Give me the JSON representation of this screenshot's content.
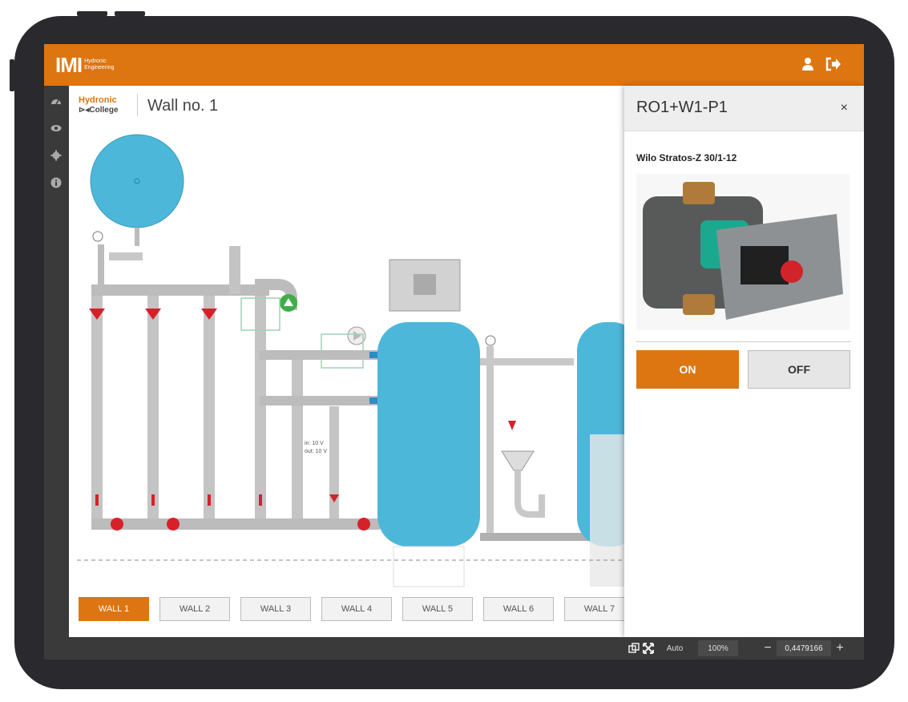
{
  "header": {
    "logo_main": "IMI",
    "logo_sub1": "Hydronic",
    "logo_sub2": "Engineering"
  },
  "sidebar": {
    "icons": [
      "dashboard-icon",
      "eye-icon",
      "gear-icon",
      "info-icon"
    ]
  },
  "page": {
    "brand_line1": "Hydronic",
    "brand_line2": "College",
    "title": "Wall no. 1"
  },
  "diagram": {
    "readout_in": "in: 10 V",
    "readout_out": "out: 10 V"
  },
  "tabs": [
    {
      "label": "WALL 1",
      "active": true
    },
    {
      "label": "WALL 2"
    },
    {
      "label": "WALL 3"
    },
    {
      "label": "WALL 4"
    },
    {
      "label": "WALL 5"
    },
    {
      "label": "WALL 6"
    },
    {
      "label": "WALL 7"
    }
  ],
  "panel": {
    "title": "RO1+W1-P1",
    "close": "×",
    "device_name": "Wilo Stratos-Z 30/1-12",
    "on_label": "ON",
    "off_label": "OFF"
  },
  "bottombar": {
    "auto_label": "Auto",
    "zoom_label": "100%",
    "zoom_value": "0,4479166"
  },
  "colors": {
    "accent": "#dd7510",
    "tank": "#4cb7d9",
    "pipe": "#bcbcbc",
    "valve": "#d8202a"
  }
}
